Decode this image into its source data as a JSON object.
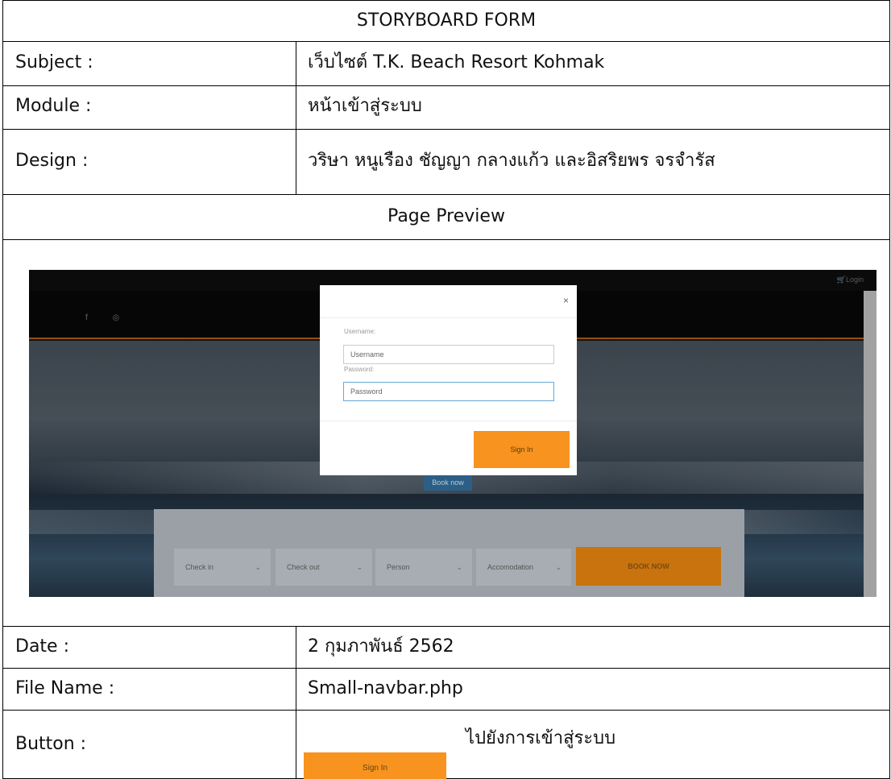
{
  "form": {
    "title": "STORYBOARD FORM",
    "rows": {
      "subject": {
        "label": "Subject :",
        "value": "เว็บไซต์ T.K. Beach Resort Kohmak"
      },
      "module": {
        "label": "Module :",
        "value": "หน้าเข้าสู่ระบบ"
      },
      "design": {
        "label": "Design :",
        "value": "วริษา หนูเรือง ชัญญา กลางแก้ว และอิสริยพร จรจำรัส"
      }
    },
    "preview_heading": "Page Preview",
    "bottom_rows": {
      "date": {
        "label": "Date :",
        "value": "2 กุมภาพันธ์ 2562"
      },
      "file_name": {
        "label": "File Name :",
        "value": "Small-navbar.php"
      },
      "button": {
        "label": "Button :",
        "button_text": "Sign In",
        "description": "ไปยังการเข้าสู่ระบบ"
      }
    }
  },
  "preview": {
    "topbar_login": "🛒Login",
    "social_icons": [
      "facebook-icon",
      "instagram-icon"
    ],
    "social_glyphs": "f ◎",
    "hero_button": "Book now",
    "booking_bar": {
      "fields": [
        "Check in",
        "Check out",
        "Person",
        "Accomodation"
      ],
      "submit": "BOOK NOW"
    },
    "modal": {
      "close": "×",
      "username_label": "Username:",
      "username_placeholder": "Username",
      "password_label": "Password:",
      "password_placeholder": "Password",
      "signin": "Sign In"
    }
  },
  "colors": {
    "accent_orange": "#f7931e",
    "booknow_orange": "#c9730e",
    "input_focus": "#66a9d6"
  }
}
